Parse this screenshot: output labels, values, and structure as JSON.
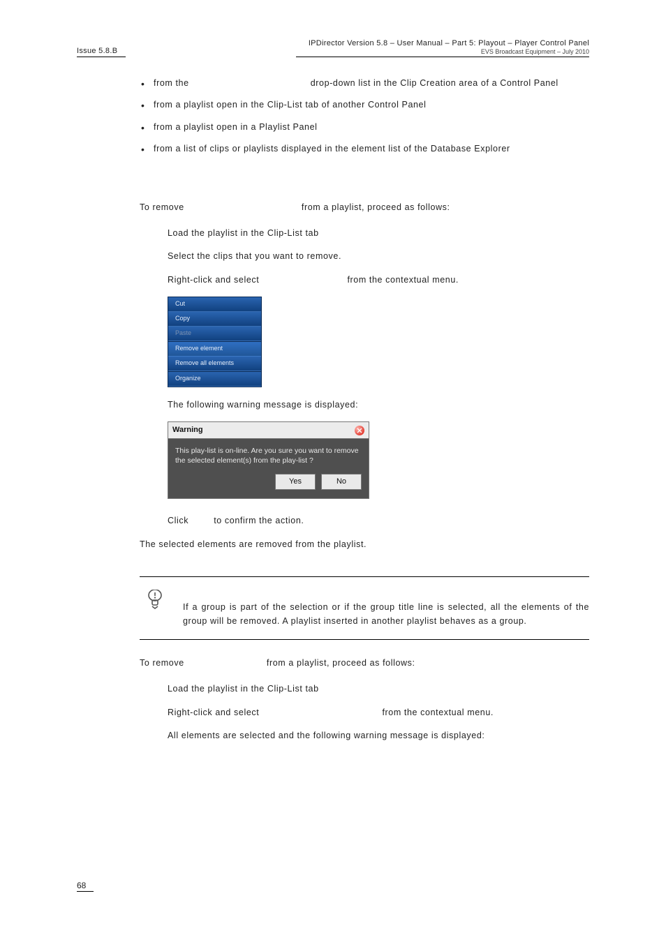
{
  "header": {
    "issue": "Issue 5.8.B",
    "title": "IPDirector Version 5.8 – User Manual – Part 5: Playout – Player Control Panel",
    "sub": "EVS Broadcast Equipment – July 2010"
  },
  "bullets": [
    {
      "pre": "from the ",
      "gap": "                                    ",
      "post": "drop-down list in the Clip Creation area of a Control Panel"
    },
    {
      "full": "from a playlist open in the Clip-List tab of another Control Panel"
    },
    {
      "full": "from a playlist open in a Playlist Panel"
    },
    {
      "full": "from a list of clips or playlists displayed in the element list of the Database Explorer"
    }
  ],
  "sectionA": {
    "intro_pre": "To remove ",
    "intro_post": " from a playlist, proceed as follows:",
    "steps": [
      "Load the playlist in the Clip-List tab",
      "Select the clips that you want to remove."
    ],
    "step3_pre": "Right-click and select ",
    "step3_post": " from the contextual menu.",
    "after_menu": "The following warning message is displayed:",
    "confirm_pre": "Click ",
    "confirm_post": " to confirm the action.",
    "result": "The selected elements are removed from the playlist."
  },
  "ctx_menu": {
    "items": [
      "Cut",
      "Copy",
      "Paste"
    ],
    "items2": [
      "Remove element",
      "Remove all elements"
    ],
    "items3": [
      "Organize"
    ]
  },
  "warning": {
    "title": "Warning",
    "body": "This play-list is on-line. Are you sure you want to remove the selected element(s) from the play-list ?",
    "yes": "Yes",
    "no": "No"
  },
  "note": "If a group is part of the selection or if the group title line is selected, all the elements of the group will be removed. A playlist inserted in another playlist behaves as a group.",
  "sectionB": {
    "intro_pre": "To remove ",
    "intro_post": " from a playlist, proceed as follows:",
    "step1": "Load the playlist in the Clip-List tab",
    "step2_pre": "Right-click and select ",
    "step2_post": " from the contextual menu.",
    "step3": "All elements are selected and the following warning message is displayed:"
  },
  "footer": {
    "page": "68"
  }
}
